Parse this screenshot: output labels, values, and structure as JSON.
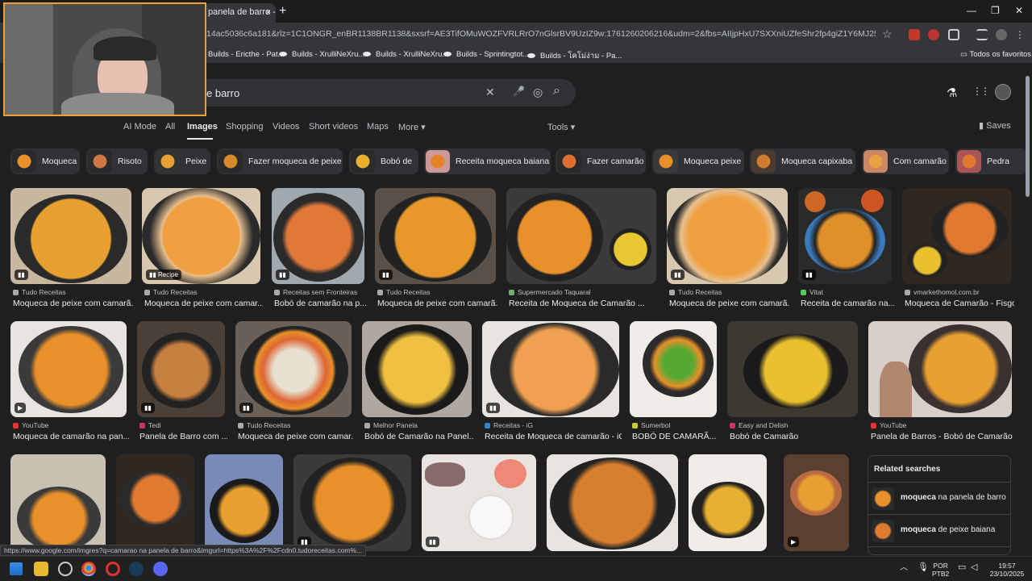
{
  "browser": {
    "tab_title": "panela de barro - G",
    "tab_close": "×",
    "new_tab": "+",
    "window_controls": [
      "—",
      "❐",
      "✕"
    ],
    "url": "14ac5036c6a181&rlz=1C1ONGR_enBR1138BR1138&sxsrf=AE3TifOMuWOZFVRLRrO7nGlsrBV9UzIZ9w:1761260206216&udm=2&fbs=AIIjpHxU7SXXniUZfeShr2fp4giZ1Y6MJ25_tmWITc7uy4KIeioyp3OhN...",
    "bookmark_star": "☆",
    "bookmarks": [
      {
        "label": "Builds - Ericthe - Pat..."
      },
      {
        "label": "Builds - XrulliNeXru..."
      },
      {
        "label": "Builds - XrulliNeXru..."
      },
      {
        "label": "Builds - Sprintingtot..."
      },
      {
        "label": "Builds - โคโม่ง่าม - Pa..."
      }
    ],
    "all_bookmarks": "Todos os favoritos"
  },
  "search": {
    "query": "e barro",
    "clear_icon": "✕",
    "mic_icon": "🎤",
    "lens_icon": "◎",
    "search_icon": "⌕"
  },
  "header": {
    "labs_icon": "⚗",
    "apps_icon": "⋮⋮"
  },
  "nav": {
    "tabs": [
      {
        "label": "AI Mode"
      },
      {
        "label": "All"
      },
      {
        "label": "Images"
      },
      {
        "label": "Shopping"
      },
      {
        "label": "Videos"
      },
      {
        "label": "Short videos"
      },
      {
        "label": "Maps"
      },
      {
        "label": "More ▾"
      }
    ],
    "tools": "Tools ▾",
    "saves": "Saves"
  },
  "chips": [
    {
      "label": "Moqueca"
    },
    {
      "label": "Risoto"
    },
    {
      "label": "Peixe"
    },
    {
      "label": "Fazer moqueca de peixe"
    },
    {
      "label": "Bobó de"
    },
    {
      "label": "Receita moqueca baiana"
    },
    {
      "label": "Fazer camarão"
    },
    {
      "label": "Moqueca peixe"
    },
    {
      "label": "Moqueca capixaba"
    },
    {
      "label": "Com camarão"
    },
    {
      "label": "Pedra"
    }
  ],
  "results": {
    "row1": [
      {
        "source": "Tudo Receitas",
        "title": "Moqueca de peixe com camarã...",
        "badge": "▮▮"
      },
      {
        "source": "Tudo Receitas",
        "title": "Moqueca de peixe com camar...",
        "badge": "▮▮ Recipe"
      },
      {
        "source": "Receitas sem Fronteiras",
        "title": "Bobó de camarão na p...",
        "badge": "▮▮"
      },
      {
        "source": "Tudo Receitas",
        "title": "Moqueca de peixe com camarã...",
        "badge": "▮▮"
      },
      {
        "source": "Supermercado Taquaral",
        "title": "Receita de Moqueca de Camarão ...",
        "badge": ""
      },
      {
        "source": "Tudo Receitas",
        "title": "Moqueca de peixe com camarã...",
        "badge": "▮▮"
      },
      {
        "source": "Vitat",
        "title": "Receita de camarão na...",
        "badge": "▮▮"
      },
      {
        "source": "vmarkethomol.com.br",
        "title": "Moqueca de Camarão - Fisgo",
        "badge": ""
      }
    ],
    "row2": [
      {
        "source": "YouTube",
        "title": "Moqueca de camarão na pan...",
        "badge": "▶"
      },
      {
        "source": "Tedi",
        "title": "Panela de Barro com ...",
        "badge": "▮▮"
      },
      {
        "source": "Tudo Receitas",
        "title": "Moqueca de peixe com camar...",
        "badge": "▮▮"
      },
      {
        "source": "Melhor Panela",
        "title": "Bobó de Camarão na Panel...",
        "badge": ""
      },
      {
        "source": "Receitas - iG",
        "title": "Receita de Moqueca de camarão - iG",
        "badge": "▮▮"
      },
      {
        "source": "Sumerbol",
        "title": "BOBÓ DE CAMARÃ...",
        "badge": ""
      },
      {
        "source": "Easy and Delish",
        "title": "Bobó de Camarão",
        "badge": ""
      },
      {
        "source": "YouTube",
        "title": "Panela de Barros - Bobó de Camarão ...",
        "badge": ""
      }
    ],
    "row3": [
      {
        "badge": ""
      },
      {
        "badge": ""
      },
      {
        "badge": ""
      },
      {
        "badge": "▮▮"
      },
      {
        "badge": "▮▮"
      },
      {
        "badge": ""
      },
      {
        "badge": ""
      },
      {
        "badge": "▶"
      }
    ]
  },
  "related": {
    "heading": "Related searches",
    "items": [
      {
        "bold": "moqueca",
        "rest": " na panela de barro"
      },
      {
        "bold": "moqueca",
        "rest": " de peixe baiana"
      }
    ]
  },
  "status_url": "https://www.google.com/imgres?q=camarao na panela de barro&imgurl=https%3A%2F%2Fcdn0.tudoreceitas.com%...",
  "taskbar": {
    "lang_1": "POR",
    "lang_2": "PTB2",
    "time": "19:57",
    "date": "23/10/2025"
  },
  "colors": {
    "accent": "#8ab4f8",
    "food_orange": "#e8902a",
    "pot_dark": "#2a2a2a"
  }
}
